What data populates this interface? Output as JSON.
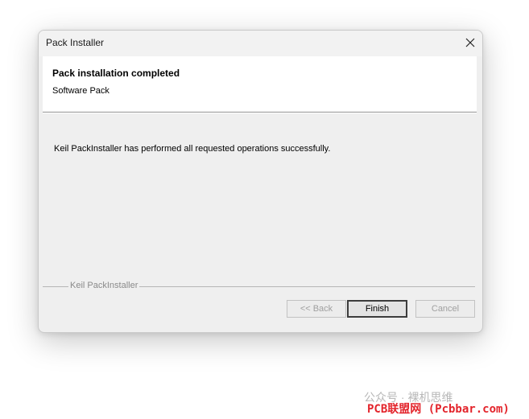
{
  "window": {
    "title": "Pack Installer",
    "close_icon": "close-icon"
  },
  "header": {
    "title": "Pack installation completed",
    "subtitle": "Software Pack"
  },
  "body": {
    "message": "Keil PackInstaller has performed all requested operations successfully."
  },
  "footer": {
    "group_label": "Keil PackInstaller"
  },
  "buttons": {
    "back": "<< Back",
    "finish": "Finish",
    "cancel": "Cancel"
  },
  "watermark": {
    "line1": "公众号 · 裸机思维",
    "line2": "PCB联盟网 (Pcbbar.com)"
  }
}
